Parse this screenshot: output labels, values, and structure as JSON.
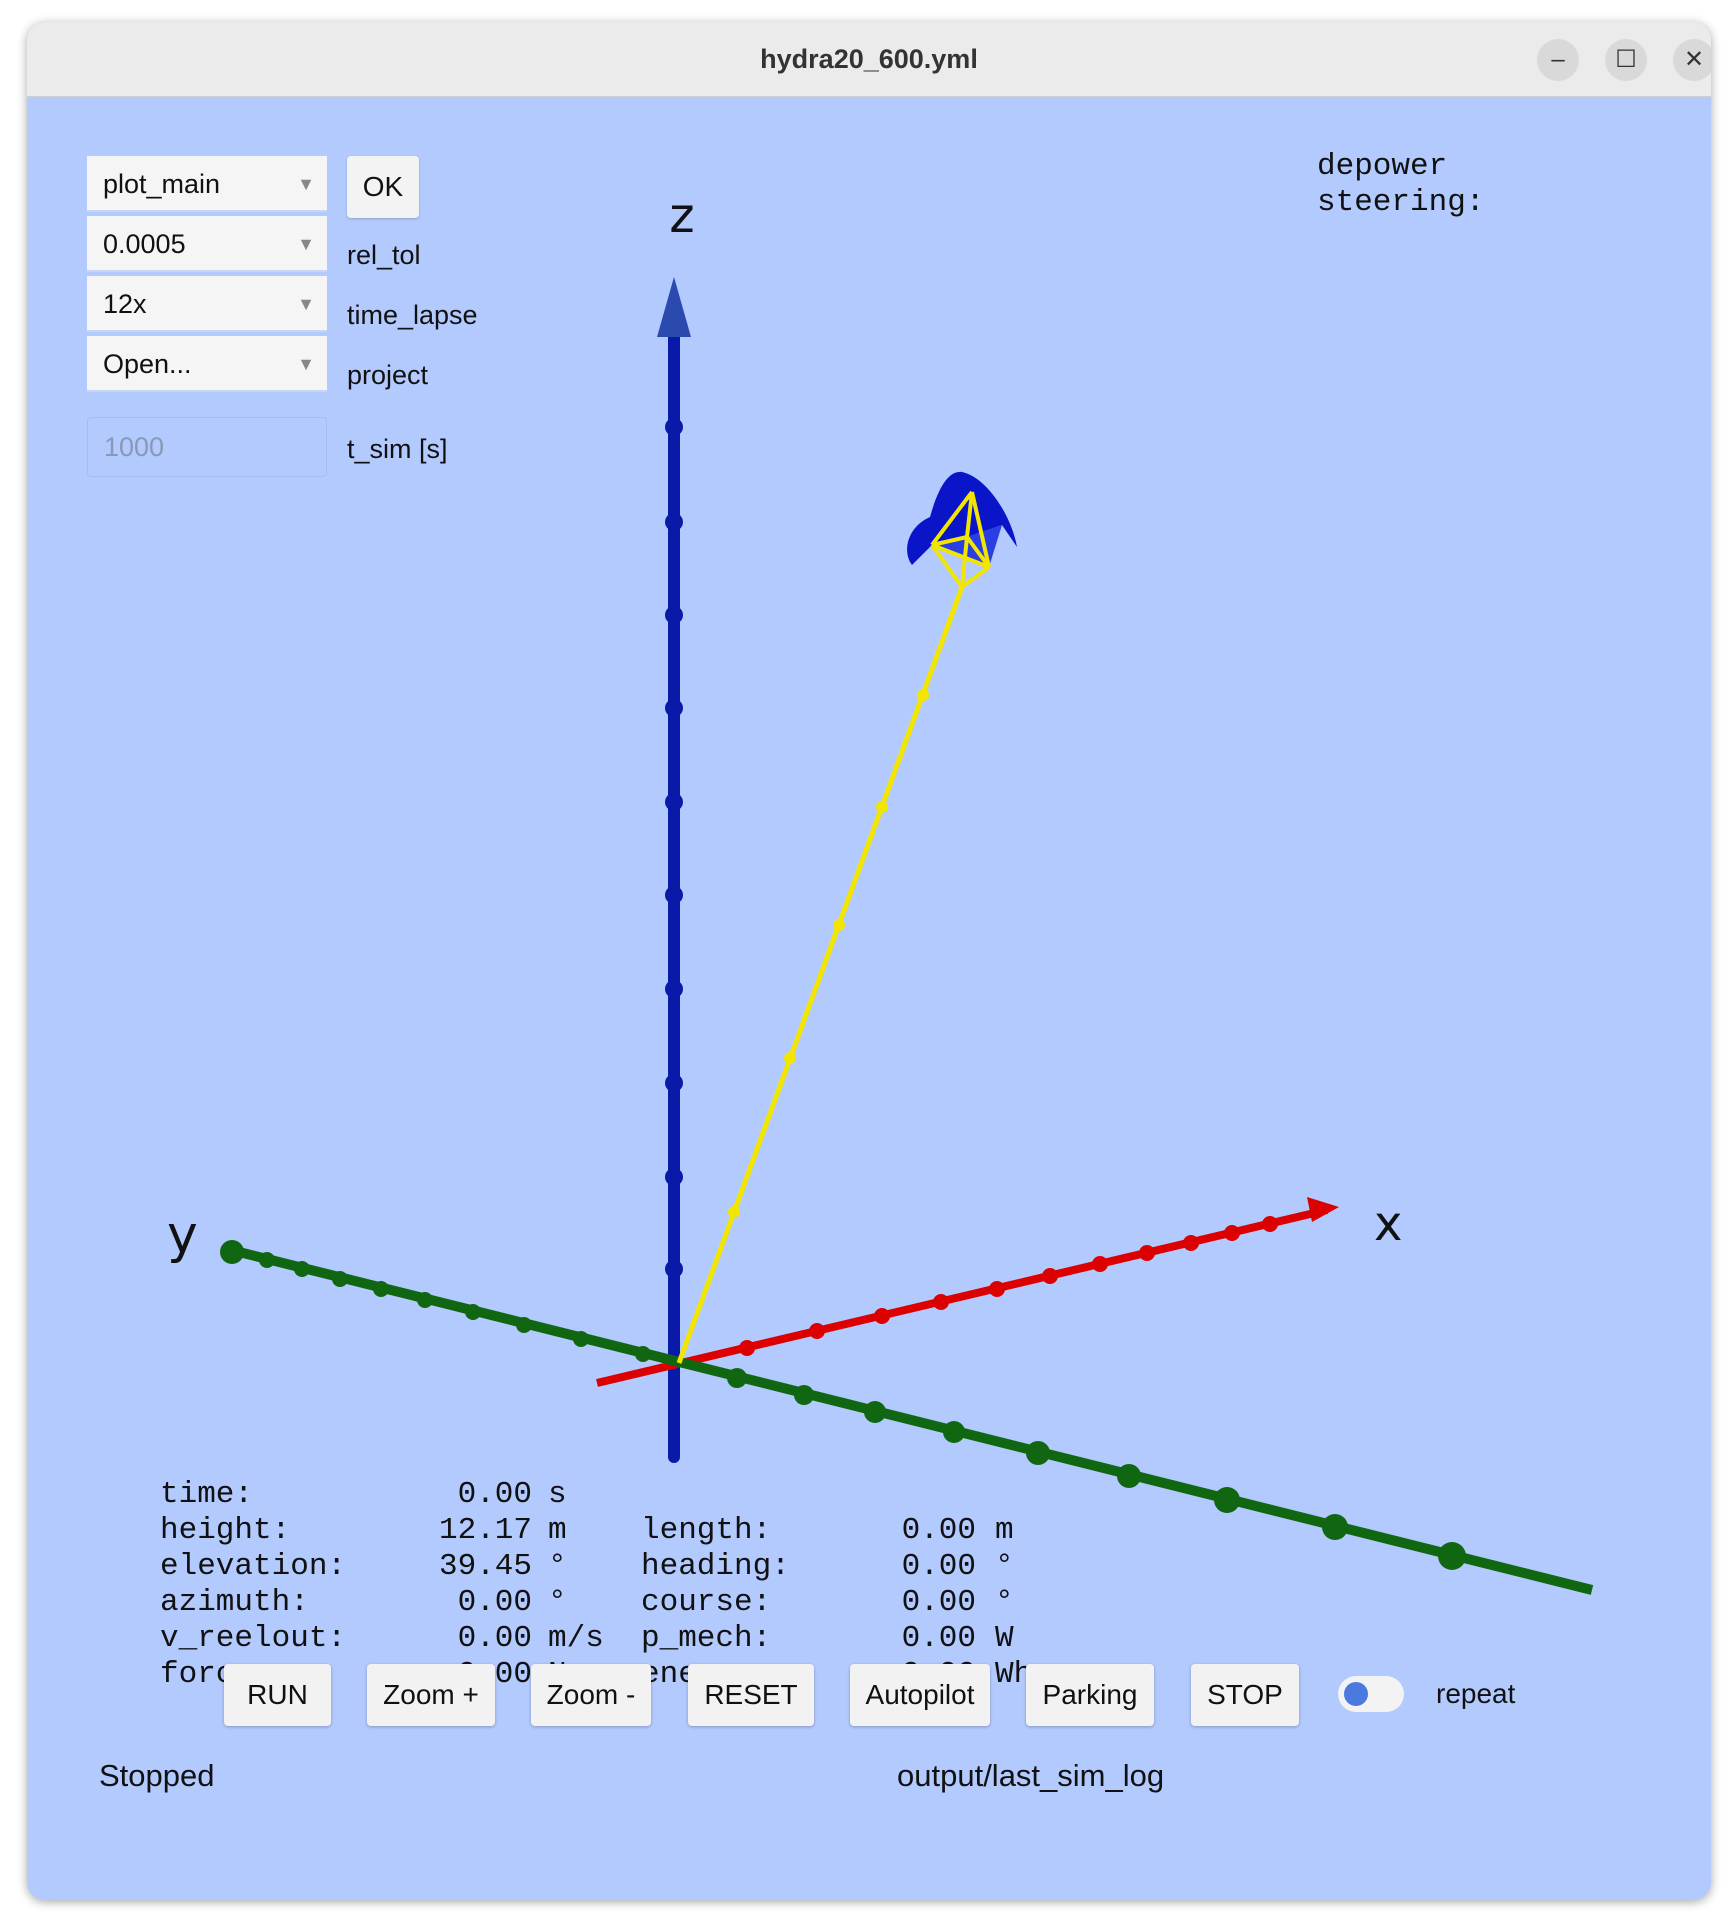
{
  "window": {
    "title": "hydra20_600.yml"
  },
  "controls": {
    "plot_dropdown": "plot_main",
    "ok_label": "OK",
    "rel_tol_value": "0.0005",
    "rel_tol_label": "rel_tol",
    "time_lapse_value": "12x",
    "time_lapse_label": "time_lapse",
    "project_value": "Open...",
    "project_label": "project",
    "t_sim_placeholder": "1000",
    "t_sim_label": "t_sim [s]"
  },
  "info": {
    "depower": "depower",
    "steering": "steering:"
  },
  "axes": {
    "x": "x",
    "y": "y",
    "z": "z"
  },
  "stats": {
    "left": [
      {
        "name": "time:",
        "value": "0.00",
        "unit": "s"
      },
      {
        "name": "height:",
        "value": "12.17",
        "unit": "m"
      },
      {
        "name": "elevation:",
        "value": "39.45",
        "unit": "°"
      },
      {
        "name": "azimuth:",
        "value": "0.00",
        "unit": "°"
      },
      {
        "name": "v_reelout:",
        "value": "0.00",
        "unit": "m/s"
      },
      {
        "name": "force:",
        "value": "0.00",
        "unit": "N"
      }
    ],
    "right": [
      {
        "name": "length:",
        "value": "0.00",
        "unit": "m"
      },
      {
        "name": "heading:",
        "value": "0.00",
        "unit": "°"
      },
      {
        "name": "course:",
        "value": "0.00",
        "unit": "°"
      },
      {
        "name": "p_mech:",
        "value": "0.00",
        "unit": "W"
      },
      {
        "name": "energy:",
        "value": "0.00",
        "unit": "Wh"
      }
    ]
  },
  "buttons": {
    "run": "RUN",
    "zoom_in": "Zoom +",
    "zoom_out": "Zoom -",
    "reset": "RESET",
    "autopilot": "Autopilot",
    "parking": "Parking",
    "stop": "STOP",
    "repeat_label": "repeat"
  },
  "status": {
    "state": "Stopped",
    "log_path": "output/last_sim_log"
  },
  "colors": {
    "background": "#b3caff",
    "x_axis": "#dd0000",
    "y_axis": "#116611",
    "z_axis": "#0a1aa8",
    "tether": "#f2e600",
    "kite": "#0a14c8"
  }
}
